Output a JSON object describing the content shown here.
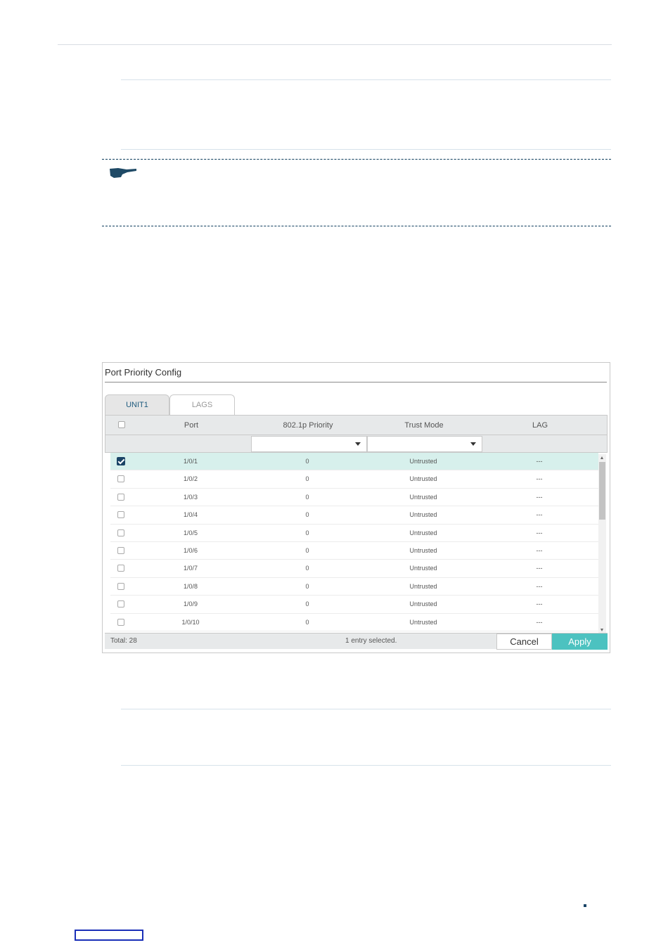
{
  "panel": {
    "title": "Port Priority Config",
    "tabs": [
      {
        "label": "UNIT1",
        "active": true
      },
      {
        "label": "LAGS",
        "active": false
      }
    ]
  },
  "table": {
    "columns": [
      "Port",
      "802.1p Priority",
      "Trust Mode",
      "LAG"
    ],
    "rows": [
      {
        "port": "1/0/1",
        "priority": "0",
        "trust": "Untrusted",
        "lag": "---",
        "checked": true
      },
      {
        "port": "1/0/2",
        "priority": "0",
        "trust": "Untrusted",
        "lag": "---",
        "checked": false
      },
      {
        "port": "1/0/3",
        "priority": "0",
        "trust": "Untrusted",
        "lag": "---",
        "checked": false
      },
      {
        "port": "1/0/4",
        "priority": "0",
        "trust": "Untrusted",
        "lag": "---",
        "checked": false
      },
      {
        "port": "1/0/5",
        "priority": "0",
        "trust": "Untrusted",
        "lag": "---",
        "checked": false
      },
      {
        "port": "1/0/6",
        "priority": "0",
        "trust": "Untrusted",
        "lag": "---",
        "checked": false
      },
      {
        "port": "1/0/7",
        "priority": "0",
        "trust": "Untrusted",
        "lag": "---",
        "checked": false
      },
      {
        "port": "1/0/8",
        "priority": "0",
        "trust": "Untrusted",
        "lag": "---",
        "checked": false
      },
      {
        "port": "1/0/9",
        "priority": "0",
        "trust": "Untrusted",
        "lag": "---",
        "checked": false
      },
      {
        "port": "1/0/10",
        "priority": "0",
        "trust": "Untrusted",
        "lag": "---",
        "checked": false
      }
    ]
  },
  "footer": {
    "total": "Total: 28",
    "selected": "1 entry selected.",
    "cancel_label": "Cancel",
    "apply_label": "Apply"
  },
  "colors": {
    "selected_row": "#d7f0ec",
    "apply": "#4cc2c0",
    "accent": "#1a4466"
  },
  "icons": {
    "note": "pointing-hand-icon",
    "checkbox": "checkbox-icon",
    "dropdown": "chevron-down-icon"
  }
}
